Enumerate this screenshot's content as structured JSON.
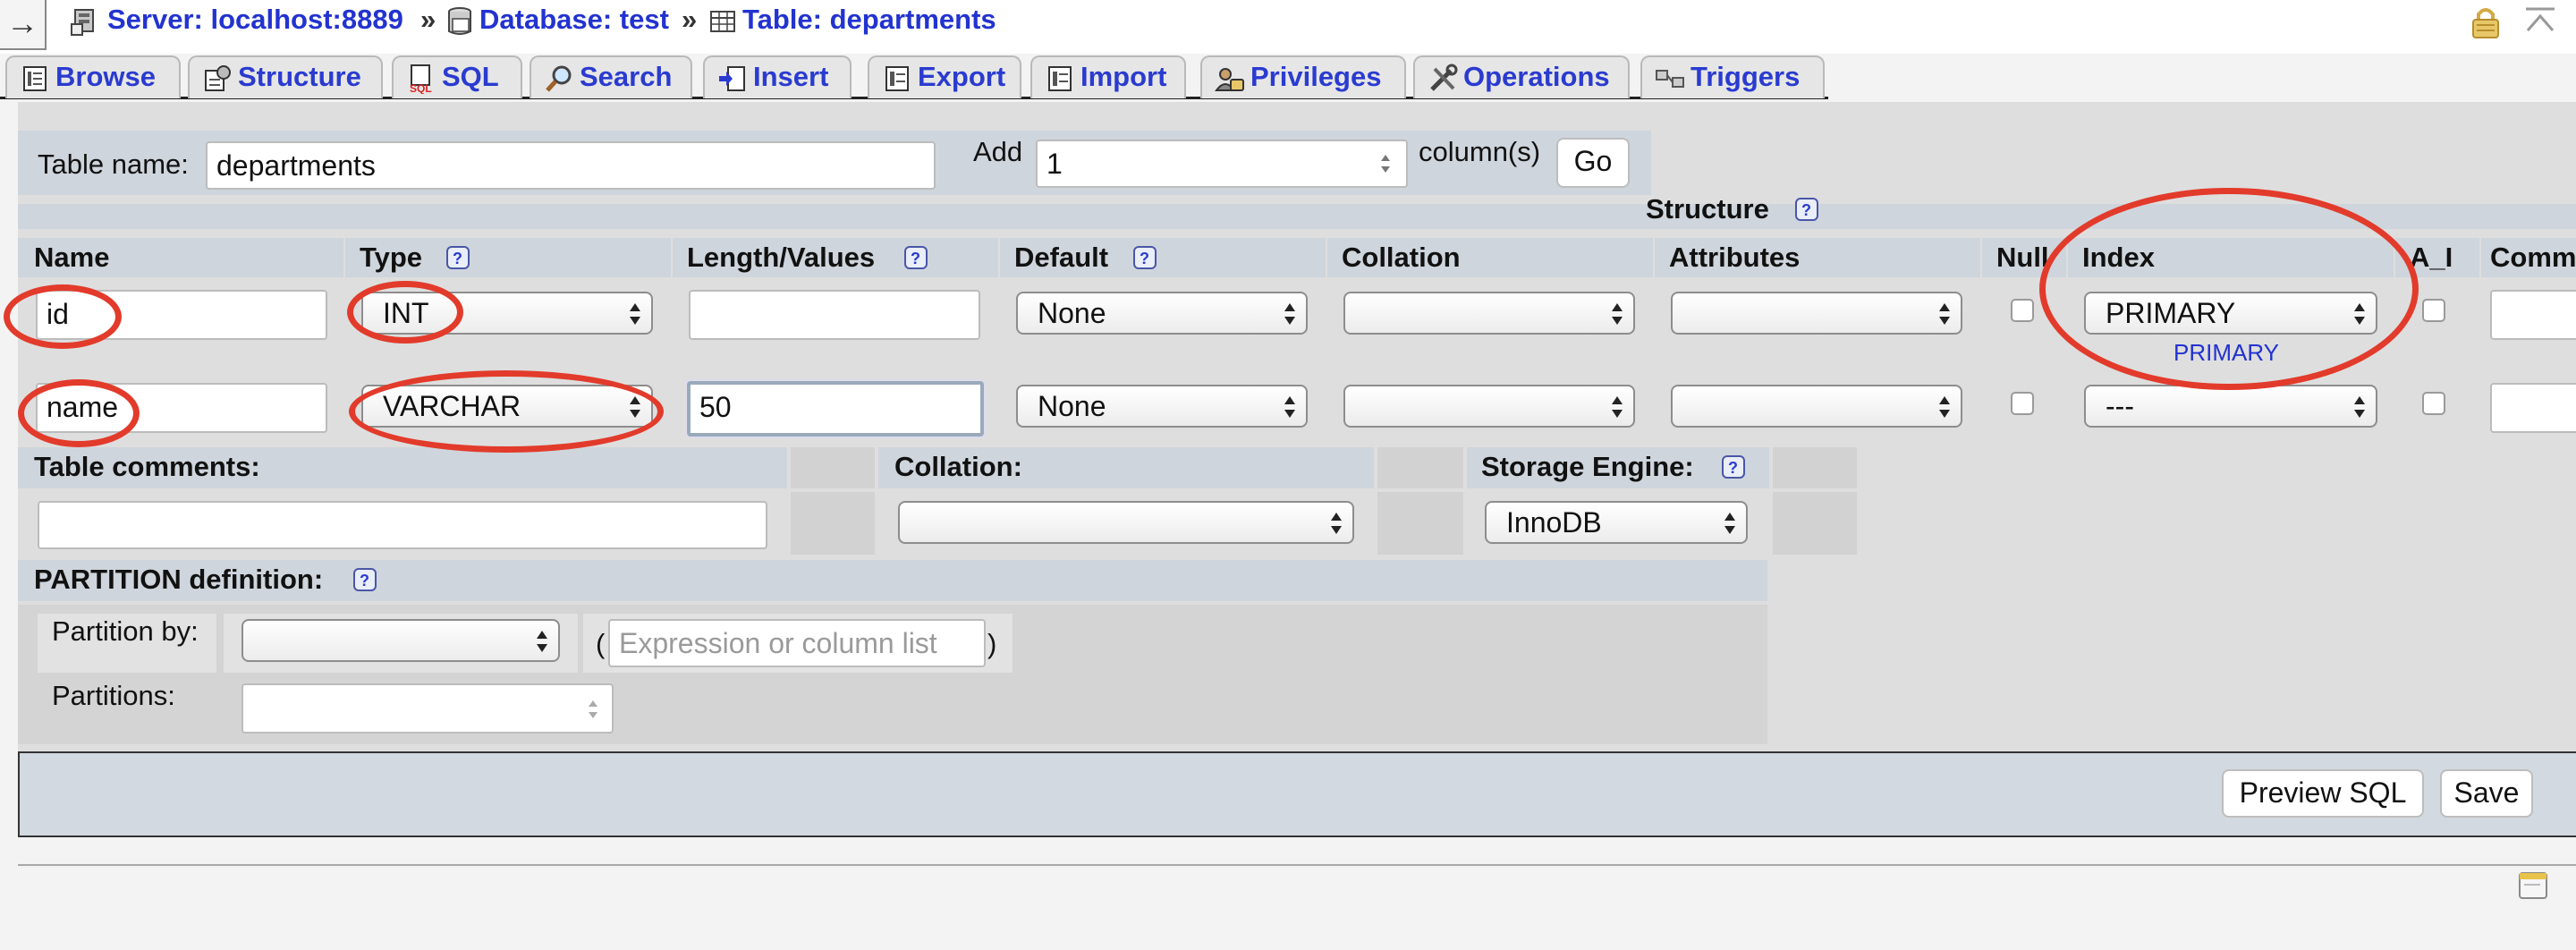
{
  "breadcrumb": {
    "server": "Server: localhost:8889",
    "database": "Database: test",
    "table": "Table: departments",
    "separator": "»"
  },
  "tabs": [
    {
      "label": "Browse",
      "icon": "browse-icon"
    },
    {
      "label": "Structure",
      "icon": "structure-icon"
    },
    {
      "label": "SQL",
      "icon": "sql-icon"
    },
    {
      "label": "Search",
      "icon": "search-icon"
    },
    {
      "label": "Insert",
      "icon": "insert-icon"
    },
    {
      "label": "Export",
      "icon": "export-icon"
    },
    {
      "label": "Import",
      "icon": "import-icon"
    },
    {
      "label": "Privileges",
      "icon": "privileges-icon"
    },
    {
      "label": "Operations",
      "icon": "operations-icon"
    },
    {
      "label": "Triggers",
      "icon": "triggers-icon"
    }
  ],
  "table_form": {
    "table_name_label": "Table name:",
    "table_name_value": "departments",
    "add_label": "Add",
    "add_count": "1",
    "columns_label": "column(s)",
    "go_label": "Go",
    "structure_label": "Structure"
  },
  "columns_header": {
    "name": "Name",
    "type": "Type",
    "length": "Length/Values",
    "default": "Default",
    "collation": "Collation",
    "attributes": "Attributes",
    "null": "Null",
    "index": "Index",
    "ai": "A_I",
    "comments": "Comm"
  },
  "rows": [
    {
      "name": "id",
      "type": "INT",
      "length": "",
      "default": "None",
      "collation": "",
      "attributes": "",
      "null": false,
      "index": "PRIMARY",
      "index_note": "PRIMARY",
      "ai": false
    },
    {
      "name": "name",
      "type": "VARCHAR",
      "length": "50",
      "default": "None",
      "collation": "",
      "attributes": "",
      "null": false,
      "index": "---",
      "index_note": "",
      "ai": false
    }
  ],
  "table_options": {
    "comments_label": "Table comments:",
    "comments_value": "",
    "collation_label": "Collation:",
    "collation_value": "",
    "engine_label": "Storage Engine:",
    "engine_value": "InnoDB"
  },
  "partition": {
    "title": "PARTITION definition:",
    "by_label": "Partition by:",
    "by_value": "",
    "open_paren": "(",
    "expression_placeholder": "Expression or column list",
    "close_paren": ")",
    "partitions_label": "Partitions:",
    "partitions_value": ""
  },
  "actions": {
    "preview_sql": "Preview SQL",
    "save": "Save"
  },
  "colors": {
    "link_blue": "#2233d0",
    "annotation_red": "#e23b2b",
    "header_cell": "#cfd5dc"
  }
}
